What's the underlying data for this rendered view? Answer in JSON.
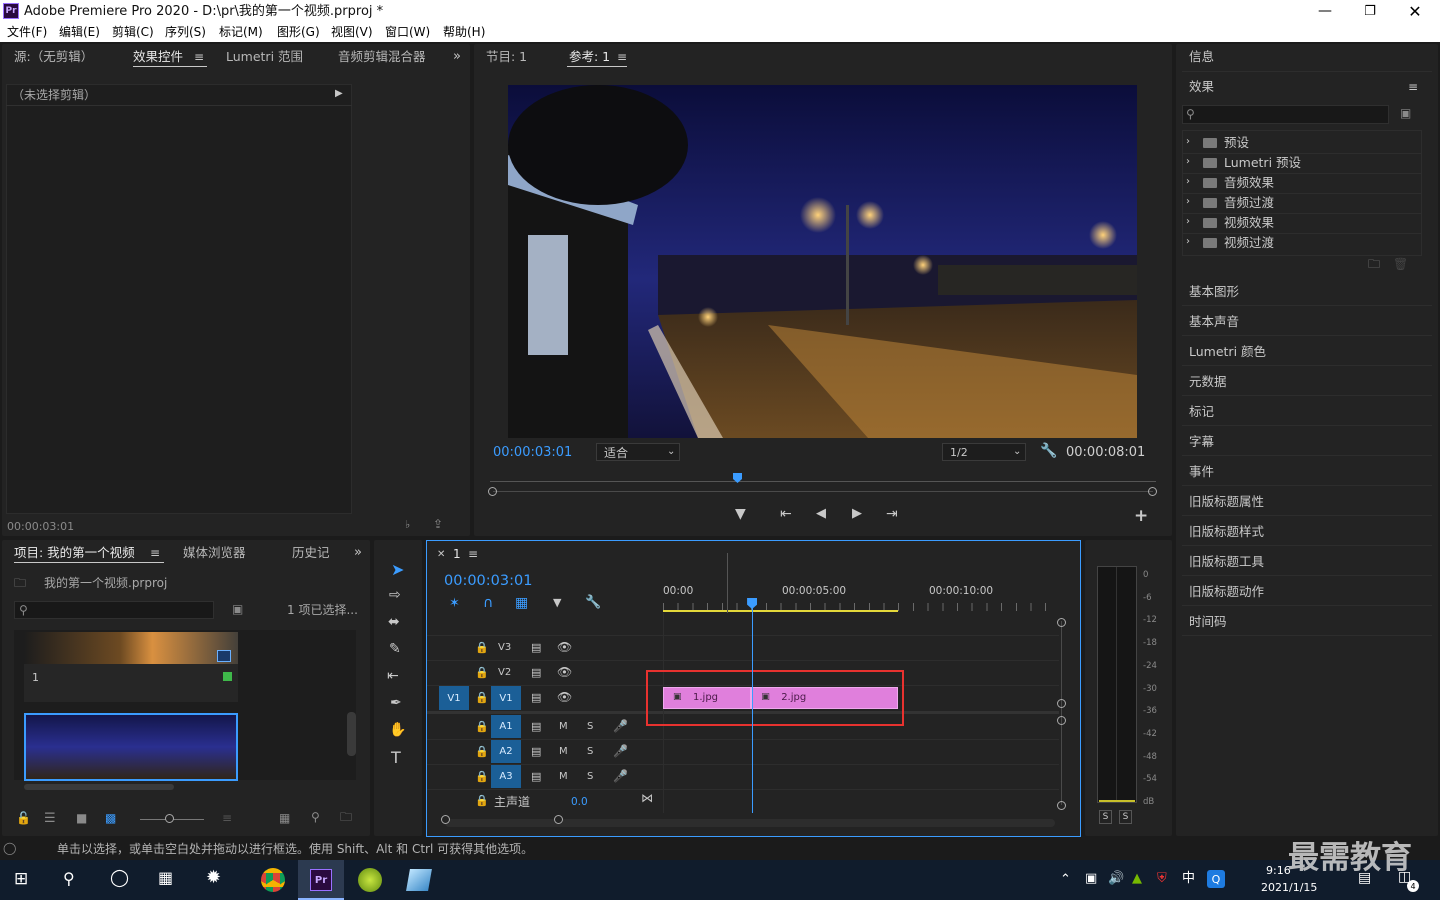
{
  "app": {
    "title": "Adobe Premiere Pro 2020 - D:\\pr\\我的第一个视频.prproj *",
    "logo": "Pr"
  },
  "menu": [
    "文件(F)",
    "编辑(E)",
    "剪辑(C)",
    "序列(S)",
    "标记(M)",
    "图形(G)",
    "视图(V)",
    "窗口(W)",
    "帮助(H)"
  ],
  "source_panel": {
    "tabs": [
      "源:（无剪辑）",
      "效果控件",
      "Lumetri 范围",
      "音频剪辑混合器"
    ],
    "active_tab": "效果控件",
    "no_clip": "（未选择剪辑）",
    "timecode": "00:00:03:01"
  },
  "program_panel": {
    "tabs": [
      "节目: 1",
      "参考: 1"
    ],
    "timecode_left": "00:00:03:01",
    "fit": "适合",
    "resolution": "1/2",
    "timecode_right": "00:00:08:01"
  },
  "project_panel": {
    "tabs": [
      "项目: 我的第一个视频",
      "媒体浏览器",
      "历史记"
    ],
    "file": "我的第一个视频.prproj",
    "selection": "1 项已选择...",
    "clip_label": "1"
  },
  "timeline": {
    "tab": "1",
    "timecode": "00:00:03:01",
    "ruler": [
      "00:00",
      "00:00:05:00",
      "00:00:10:00"
    ],
    "video_tracks": [
      "V3",
      "V2",
      "V1"
    ],
    "source_patch": "V1",
    "audio_tracks": [
      "A1",
      "A2",
      "A3"
    ],
    "mute": "M",
    "solo": "S",
    "master": "主声道",
    "master_value": "0.0",
    "clips": [
      {
        "name": "1.jpg",
        "start": 0,
        "end": 3
      },
      {
        "name": "2.jpg",
        "start": 3,
        "end": 8
      }
    ],
    "playhead_seconds": 3.03
  },
  "meter": {
    "scale": [
      "0",
      "-6",
      "-12",
      "-18",
      "-24",
      "-30",
      "-36",
      "-42",
      "-48",
      "-54",
      "dB"
    ],
    "solo": [
      "S",
      "S"
    ]
  },
  "right_panel": {
    "info": "信息",
    "effects_title": "效果",
    "effects_tree": [
      "预设",
      "Lumetri 预设",
      "音频效果",
      "音频过渡",
      "视频效果",
      "视频过渡"
    ],
    "items": [
      "基本图形",
      "基本声音",
      "Lumetri 颜色",
      "元数据",
      "标记",
      "字幕",
      "事件",
      "旧版标题属性",
      "旧版标题样式",
      "旧版标题工具",
      "旧版标题动作",
      "时间码"
    ]
  },
  "status": {
    "text": "单击以选择，或单击空白处并拖动以进行框选。使用 Shift、Alt 和 Ctrl 可获得其他选项。"
  },
  "taskbar": {
    "time": "9:16",
    "date": "2021/1/15",
    "ime": "中",
    "notifications": "4",
    "watermark": "最需教育"
  },
  "colors": {
    "accent_blue": "#3b9cff",
    "clip_pink": "#e07fdc",
    "highlight_red": "#e8322f",
    "track_blue": "#1b5f97"
  }
}
